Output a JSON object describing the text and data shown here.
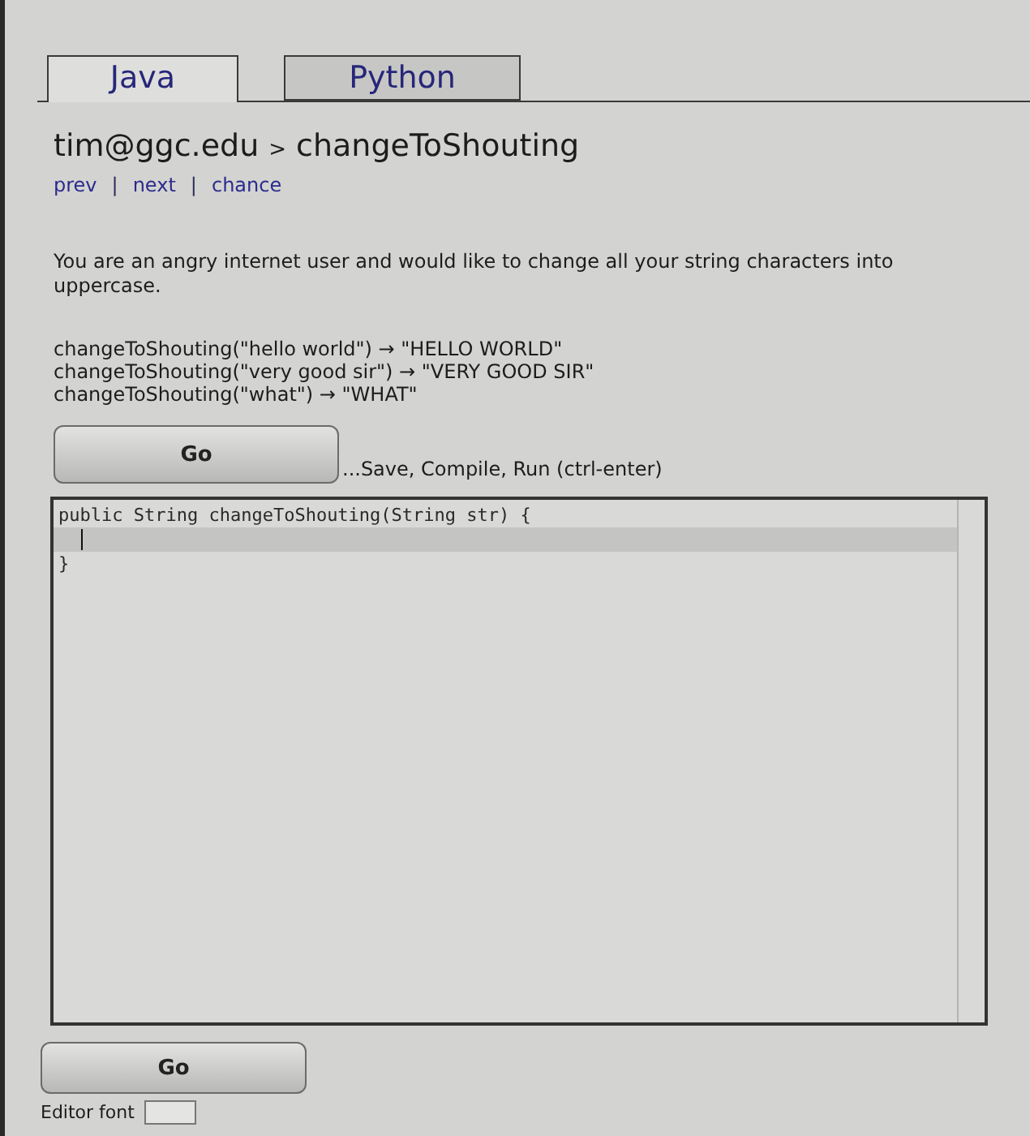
{
  "tabs": [
    {
      "label": "Java",
      "selected": true
    },
    {
      "label": "Python",
      "selected": false
    }
  ],
  "breadcrumb": {
    "user": "tim@ggc.edu",
    "separator": ">",
    "problem": "changeToShouting"
  },
  "nav_links": [
    {
      "label": "prev",
      "separator": "|"
    },
    {
      "label": "next",
      "separator": "|"
    },
    {
      "label": "chance"
    }
  ],
  "description": "You are an angry internet user and would like to change all your string characters into uppercase.",
  "examples": [
    "changeToShouting(\"hello world\") → \"HELLO WORLD\"",
    "changeToShouting(\"very good sir\") → \"VERY GOOD SIR\"",
    "changeToShouting(\"what\") → \"WHAT\""
  ],
  "go_button": {
    "label": "Go",
    "hint": "...Save, Compile, Run (ctrl-enter)"
  },
  "editor": {
    "lines": [
      {
        "text": "public String changeToShouting(String str) {",
        "current": false
      },
      {
        "current": true
      },
      {
        "text": "}",
        "current": false
      }
    ]
  },
  "bottom_go_button": {
    "label": "Go"
  },
  "font_size_setting": {
    "label": "Editor font"
  }
}
